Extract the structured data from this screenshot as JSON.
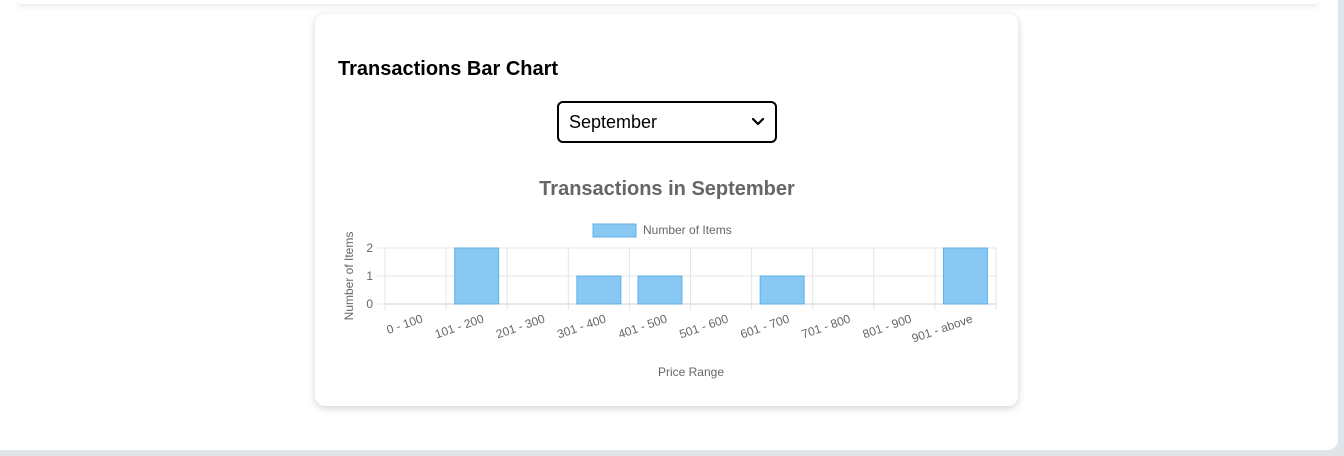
{
  "page": {
    "heading": "Transactions Bar Chart",
    "month_select": {
      "selected": "September"
    }
  },
  "chart_data": {
    "type": "bar",
    "title": "Transactions in September",
    "categories": [
      "0 - 100",
      "101 - 200",
      "201 - 300",
      "301 - 400",
      "401 - 500",
      "501 - 600",
      "601 - 700",
      "701 - 800",
      "801 - 900",
      "901 - above"
    ],
    "series": [
      {
        "name": "Number of Items",
        "values": [
          0,
          2,
          0,
          1,
          1,
          0,
          1,
          0,
          0,
          2
        ],
        "color": "#88c8f2",
        "border": "#5eb0e8"
      }
    ],
    "xlabel": "Price Range",
    "ylabel": "Number of Items",
    "ylim": [
      0,
      2
    ],
    "yticks": [
      "0",
      "1",
      "2"
    ],
    "grid": true,
    "legend": "top"
  }
}
